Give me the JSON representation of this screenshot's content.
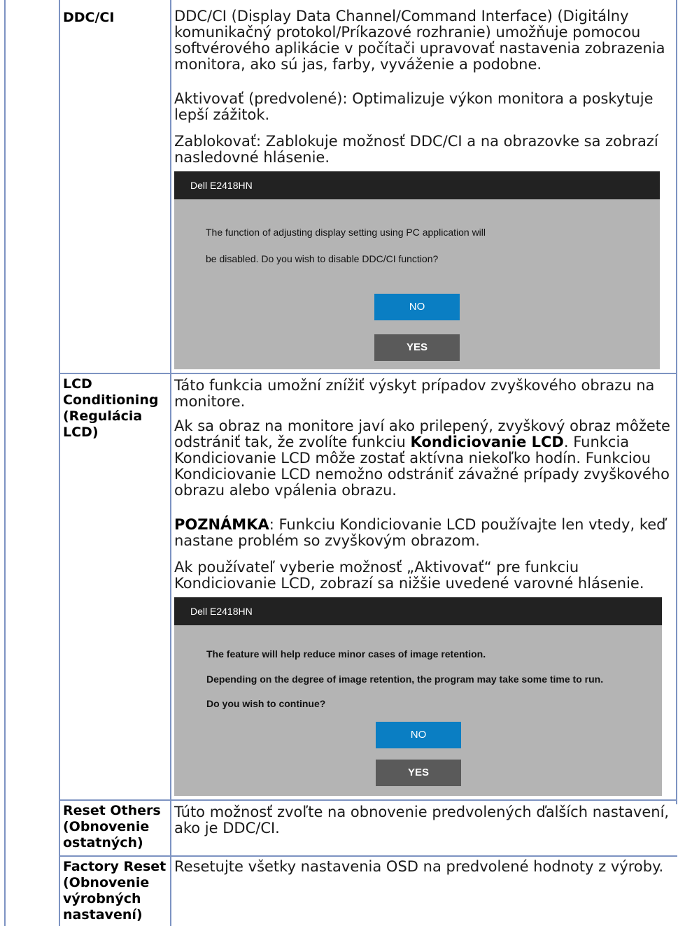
{
  "rows": {
    "ddcci": {
      "term": "DDC/CI",
      "p1": "DDC/CI (Display Data Channel/Command Interface) (Digitálny komunikačný protokol/Príkazové rozhranie) umožňuje pomocou softvérového aplikácie v počítači upravovať nastavenia zobrazenia monitora, ako sú jas, farby, vyváženie a podobne.",
      "p2": "Aktivovať (predvolené): Optimalizuje výkon monitora a poskytuje lepší zážitok.",
      "p3": "Zablokovať: Zablokuje možnosť DDC/CI a na obrazovke sa zobrazí nasledovné hlásenie.",
      "dialog": {
        "title": "Dell E2418HN",
        "line1": "The function of adjusting display setting using PC application will",
        "line2": "be disabled. Do you wish to disable DDC/CI function?",
        "no_label": "NO",
        "yes_label": "YES"
      }
    },
    "lcd": {
      "term_line1": "LCD",
      "term_line2": "Conditioning",
      "term_line3": "(Regulácia",
      "term_line4": "LCD)",
      "p1": "Táto funkcia umožní znížiť výskyt prípadov zvyškového obrazu na monitore.",
      "p2_before": "Ak sa obraz na monitore javí ako prilepený, zvyškový obraz môžete odstrániť tak, že zvolíte funkciu ",
      "p2_bold": "Kondiciovanie LCD",
      "p2_after": ". Funkcia Kondiciovanie LCD môže zostať aktívna niekoľko hodín. Funkciou Kondiciovanie LCD nemožno odstrániť závažné prípady zvyškového obrazu alebo vpálenia obrazu.",
      "note_bold": "POZNÁMKA",
      "note_text": ": Funkciu Kondiciovanie LCD používajte len vtedy, keď nastane problém so zvyškovým obrazom.",
      "p4": "Ak používateľ vyberie možnosť „Aktivovať“ pre funkciu Kondiciovanie LCD, zobrazí sa nižšie uvedené varovné hlásenie.",
      "dialog": {
        "title": "Dell E2418HN",
        "line1": "The feature will help reduce minor cases of image retention.",
        "line2": "Depending on the degree of image retention, the program may take some time to run.",
        "line3": "Do you wish to continue?",
        "no_label": "NO",
        "yes_label": "YES"
      }
    },
    "reset_others": {
      "term_line1": "Reset Others",
      "term_line2": "(Obnovenie",
      "term_line3": "ostatných)",
      "desc": "Túto možnosť zvoľte na obnovenie predvolených ďalších nastavení, ako je DDC/CI."
    },
    "factory_reset": {
      "term_line1": "Factory Reset",
      "term_line2": "(Obnovenie",
      "term_line3": "výrobných",
      "term_line4": "nastavení)",
      "desc": "Resetujte všetky nastavenia OSD na predvolené hodnoty z výroby."
    }
  }
}
